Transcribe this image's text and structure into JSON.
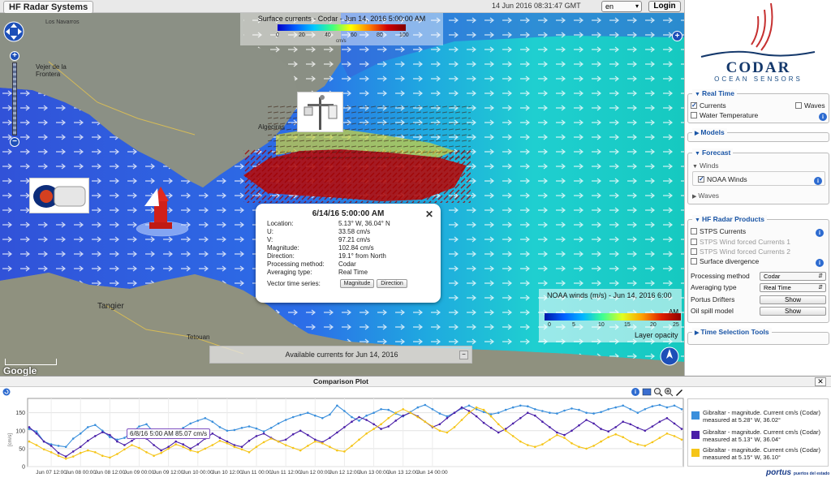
{
  "app": {
    "title": "HF Radar Systems",
    "datetime": "14 Jun 2016 08:31:47 GMT",
    "language": "en",
    "login_label": "Login"
  },
  "map": {
    "legend_top": {
      "title": "Surface currents - Codar - Jun 14, 2016 5:00:00 AM",
      "ticks": [
        "0",
        "20",
        "40",
        "60",
        "80",
        "100"
      ],
      "unit": "cm/s"
    },
    "legend_bottom": {
      "title": "NOAA winds (m/s) - Jun 14, 2016 6:00",
      "am": "AM",
      "ticks": [
        "0",
        "5",
        "10",
        "15",
        "20",
        "25"
      ],
      "layer_opacity": "Layer opacity"
    },
    "available_text": "Available currents for Jun 14, 2016",
    "google": "Google",
    "popup": {
      "title": "6/14/16 5:00:00 AM",
      "rows": [
        {
          "k": "Location:",
          "v": "5.13° W, 36.04° N"
        },
        {
          "k": "U:",
          "v": "33.58 cm/s"
        },
        {
          "k": "V:",
          "v": "97.21 cm/s"
        },
        {
          "k": "Magnitude:",
          "v": "102.84 cm/s"
        },
        {
          "k": "Direction:",
          "v": "19.1° from North"
        },
        {
          "k": "Processing method:",
          "v": "Codar"
        },
        {
          "k": "Averaging type:",
          "v": "Real Time"
        }
      ],
      "series_label": "Vector time series:",
      "magnitude_btn": "Magnitude",
      "direction_btn": "Direction"
    },
    "place_labels": [
      "Los Navarros",
      "Vejer de la Frontera",
      "Algeciras",
      "Tangier",
      "Tetouan"
    ]
  },
  "sidebar": {
    "logo_name": "CODAR",
    "logo_sub": "OCEAN SENSORS",
    "realtime": {
      "title": "Real Time",
      "currents": "Currents",
      "waves": "Waves",
      "water_temp": "Water Temperature"
    },
    "models": {
      "title": "Models"
    },
    "forecast": {
      "title": "Forecast",
      "winds": "Winds",
      "noaa_winds": "NOAA Winds",
      "waves": "Waves"
    },
    "hf_products": {
      "title": "HF Radar Products",
      "stps": "STPS Currents",
      "stps1": "STPS Wind forced Currents 1",
      "stps2": "STPS Wind forced Currents 2",
      "surface_div": "Surface divergence",
      "proc_label": "Processing method",
      "proc_value": "Codar",
      "avg_label": "Averaging type",
      "avg_value": "Real Time",
      "drifters_label": "Portus Drifters",
      "drifters_btn": "Show",
      "oil_label": "Oil spill model",
      "oil_btn": "Show"
    },
    "time_tools": {
      "title": "Time Selection Tools"
    }
  },
  "plot": {
    "title": "Comparison Plot",
    "tooltip": "6/8/16 5:00 AM 85.07 cm/s",
    "ylabel": "[cm/s]",
    "logo": "portus",
    "logo_sub": "puertos del estado",
    "legend": [
      {
        "text": "Gibraltar - magnitude. Current cm/s (Codar) measured at 5.28° W, 36.02°",
        "color": "#3a8fdc"
      },
      {
        "text": "Gibraltar - magnitude. Current cm/s (Codar) measured at 5.13° W, 36.04°",
        "color": "#4a1fa8"
      },
      {
        "text": "Gibraltar - magnitude. Current cm/s (Codar) measured at 5.15° W, 36.10°",
        "color": "#f5c518"
      }
    ]
  },
  "chart_data": {
    "type": "line",
    "title": "Comparison Plot",
    "ylabel": "[cm/s]",
    "ylim": [
      0,
      190
    ],
    "yticks": [
      0,
      50,
      100,
      150
    ],
    "xticks": [
      "Jun 07 12:00",
      "Jun 08 00:00",
      "Jun 08 12:00",
      "Jun 09 00:00",
      "Jun 09 12:00",
      "Jun 10 00:00",
      "Jun 10 12:00",
      "Jun 11 00:00",
      "Jun 11 12:00",
      "Jun 12 00:00",
      "Jun 12 12:00",
      "Jun 13 00:00",
      "Jun 13 12:00",
      "Jun 14 00:00"
    ],
    "x_start_hours_before_first_tick": 9,
    "x_step_hours": 3,
    "grid": true,
    "series": [
      {
        "name": "Gibraltar - magnitude. Current cm/s (Codar) measured at 5.28° W, 36.02°",
        "color": "#3a8fdc",
        "values": [
          105,
          98,
          70,
          62,
          58,
          55,
          78,
          92,
          110,
          116,
          100,
          82,
          75,
          80,
          95,
          112,
          118,
          96,
          88,
          80,
          92,
          108,
          120,
          128,
          135,
          125,
          110,
          100,
          102,
          108,
          112,
          106,
          98,
          108,
          120,
          130,
          138,
          144,
          150,
          142,
          135,
          145,
          170,
          155,
          138,
          128,
          142,
          150,
          160,
          158,
          148,
          140,
          152,
          165,
          172,
          160,
          148,
          140,
          150,
          162,
          170,
          160,
          152,
          146,
          150,
          158,
          165,
          170,
          168,
          160,
          155,
          150,
          148,
          156,
          162,
          158,
          150,
          148,
          152,
          160,
          165,
          170,
          160,
          150,
          160,
          168,
          172,
          165,
          170,
          160
        ]
      },
      {
        "name": "Gibraltar - magnitude. Current cm/s (Codar) measured at 5.13° W, 36.04°",
        "color": "#4a1fa8",
        "values": [
          110,
          92,
          70,
          58,
          38,
          28,
          42,
          55,
          72,
          85,
          96,
          88,
          70,
          60,
          72,
          85,
          78,
          60,
          45,
          55,
          70,
          62,
          50,
          62,
          78,
          92,
          80,
          70,
          60,
          55,
          72,
          85,
          92,
          80,
          70,
          75,
          90,
          100,
          88,
          75,
          68,
          80,
          95,
          110,
          125,
          138,
          130,
          118,
          105,
          112,
          128,
          142,
          150,
          140,
          125,
          110,
          118,
          135,
          150,
          165,
          155,
          140,
          122,
          108,
          95,
          105,
          120,
          135,
          150,
          142,
          125,
          110,
          95,
          88,
          100,
          115,
          130,
          120,
          105,
          98,
          110,
          125,
          118,
          108,
          100,
          112,
          125,
          135,
          120,
          105
        ]
      },
      {
        "name": "Gibraltar - magnitude. Current cm/s (Codar) measured at 5.15° W, 36.10°",
        "color": "#f5c518",
        "values": [
          70,
          60,
          48,
          40,
          30,
          22,
          28,
          38,
          45,
          40,
          30,
          25,
          35,
          48,
          60,
          52,
          40,
          30,
          38,
          50,
          62,
          55,
          45,
          40,
          50,
          60,
          72,
          65,
          55,
          48,
          40,
          55,
          68,
          78,
          70,
          60,
          52,
          45,
          58,
          70,
          65,
          55,
          45,
          42,
          58,
          75,
          92,
          105,
          118,
          135,
          150,
          160,
          150,
          138,
          125,
          112,
          100,
          95,
          110,
          130,
          150,
          165,
          158,
          140,
          118,
          100,
          85,
          70,
          60,
          55,
          62,
          75,
          88,
          80,
          65,
          55,
          50,
          58,
          70,
          82,
          90,
          82,
          70,
          62,
          58,
          68,
          80,
          92,
          85,
          75
        ]
      }
    ]
  }
}
